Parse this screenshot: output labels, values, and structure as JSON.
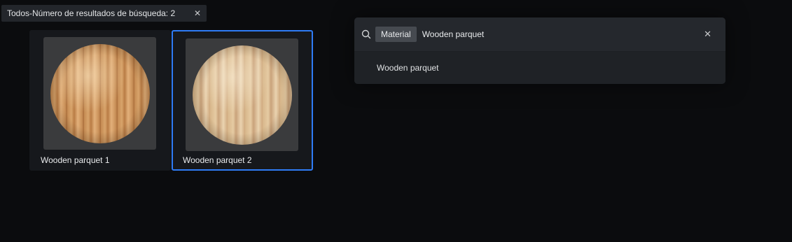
{
  "filter_chip": {
    "label": "Todos-Número de resultados de búsqueda: 2",
    "close_symbol": "✕"
  },
  "results": [
    {
      "name": "Wooden parquet 1",
      "selected": false,
      "icon": "wood-sphere-thumbnail"
    },
    {
      "name": "Wooden parquet 2",
      "selected": true,
      "icon": "wood-sphere-thumbnail"
    }
  ],
  "search": {
    "icon": "search-icon",
    "category_tag": "Material",
    "query": "Wooden parquet",
    "clear_symbol": "✕",
    "suggestions": [
      "Wooden parquet"
    ]
  },
  "colors": {
    "selection_border": "#2f7cf6",
    "background": "#0b0c0e"
  }
}
